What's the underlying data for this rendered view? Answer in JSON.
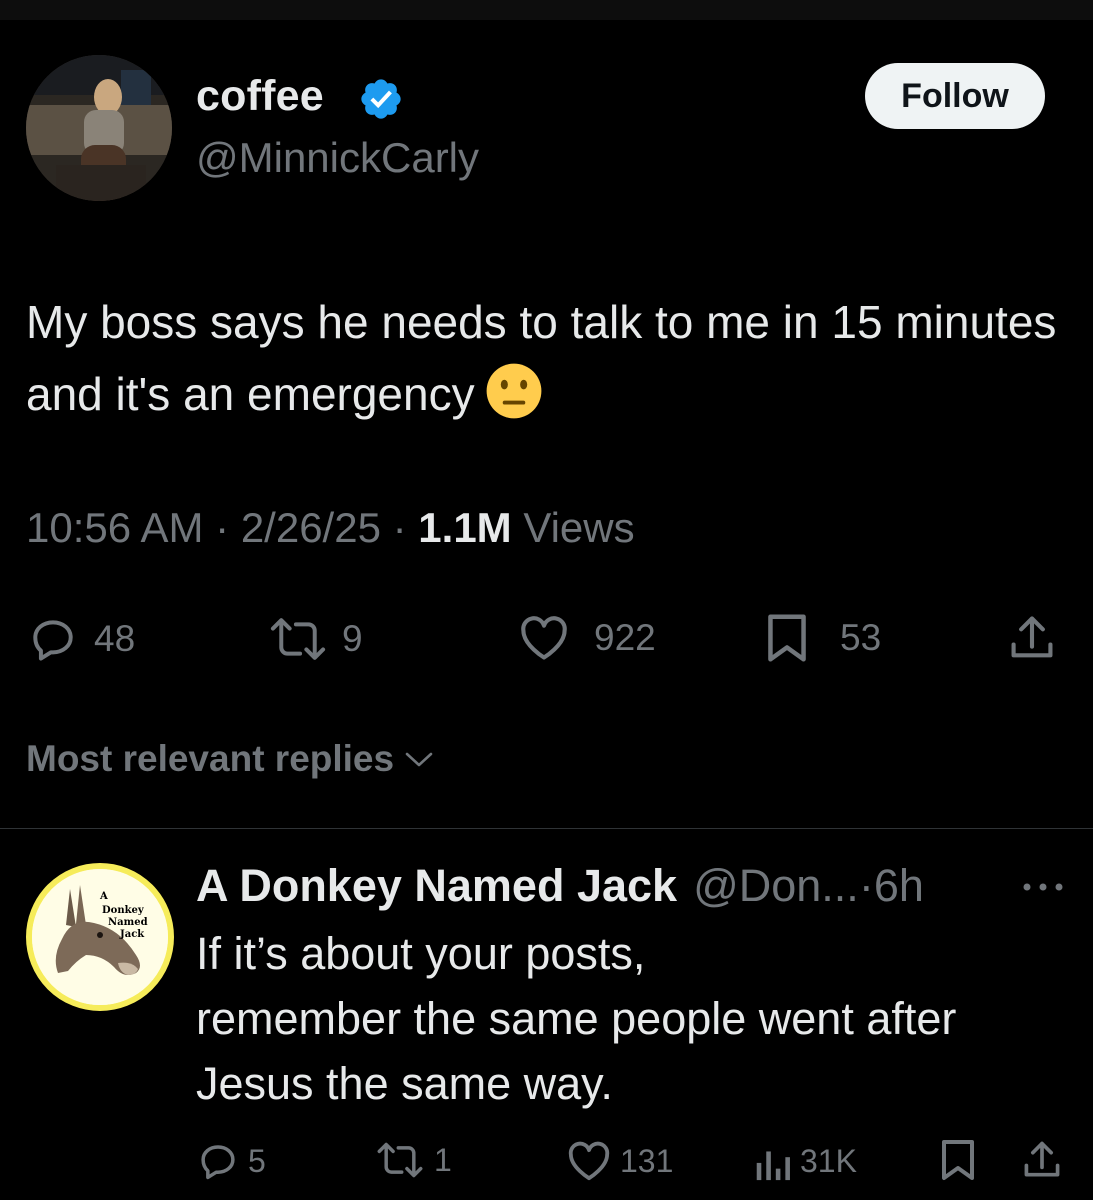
{
  "tweet": {
    "author_name": "coffee",
    "author_handle": "@MinnickCarly",
    "follow_label": "Follow",
    "text": "My boss says he needs to talk to me in 15 minutes and it's an emergency",
    "emoji": "neutral-face",
    "time": "10:56 AM",
    "date": "2/26/25",
    "views_count": "1.1M",
    "views_label": "Views",
    "separator": "·",
    "actions": {
      "replies": "48",
      "reposts": "9",
      "likes": "922",
      "bookmarks": "53"
    }
  },
  "replies_section": {
    "sort_label": "Most relevant replies"
  },
  "reply": {
    "author_name": "A Donkey Named Jack",
    "author_handle": "@Don...",
    "time": "6h",
    "separator": "·",
    "avatar_text": "A Donkey Named Jack",
    "text": "If it’s about your posts,\nremember the same people went after\nJesus the same way.",
    "actions": {
      "replies": "5",
      "reposts": "1",
      "likes": "131",
      "views": "31K"
    }
  },
  "colors": {
    "background": "#000000",
    "primary_text": "#e7e9ea",
    "secondary_text": "#71767b",
    "verified_blue": "#1d9bf0",
    "divider": "#2f3336",
    "follow_button_bg": "#eff3f4"
  }
}
